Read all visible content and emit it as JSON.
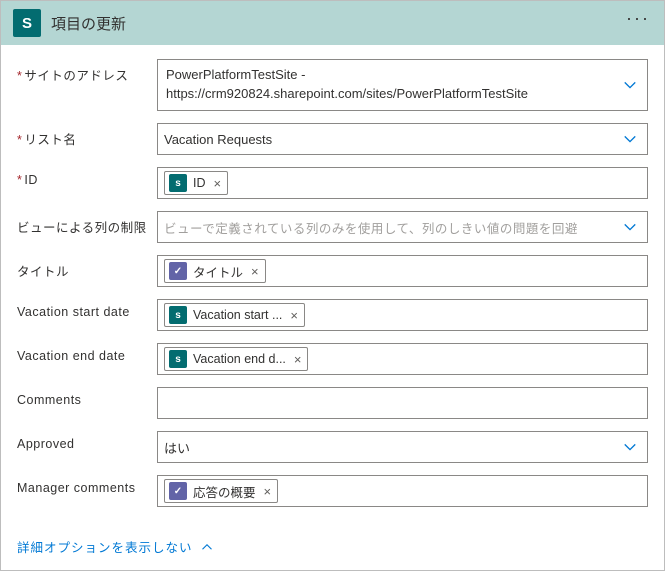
{
  "header": {
    "icon_letter": "S",
    "title": "項目の更新",
    "more": "···"
  },
  "fields": {
    "site_address": {
      "label": "サイトのアドレス",
      "line1": "PowerPlatformTestSite -",
      "line2": "https://crm920824.sharepoint.com/sites/PowerPlatformTestSite"
    },
    "list_name": {
      "label": "リスト名",
      "value": "Vacation Requests"
    },
    "id": {
      "label": "ID",
      "token": {
        "source": "sp",
        "text": "ID"
      }
    },
    "limit_columns": {
      "label": "ビューによる列の制限",
      "placeholder": "ビューで定義されている列のみを使用して、列のしきい値の問題を回避"
    },
    "title": {
      "label": "タイトル",
      "token": {
        "source": "ap",
        "text": "タイトル"
      }
    },
    "vac_start": {
      "label": "Vacation start date",
      "token": {
        "source": "sp",
        "text": "Vacation start ..."
      }
    },
    "vac_end": {
      "label": "Vacation end date",
      "token": {
        "source": "sp",
        "text": "Vacation end d..."
      }
    },
    "comments": {
      "label": "Comments"
    },
    "approved": {
      "label": "Approved",
      "value": "はい"
    },
    "manager_comments": {
      "label": "Manager comments",
      "token": {
        "source": "ap",
        "text": "応答の概要"
      }
    }
  },
  "footer": {
    "toggle": "詳細オプションを表示しない"
  }
}
